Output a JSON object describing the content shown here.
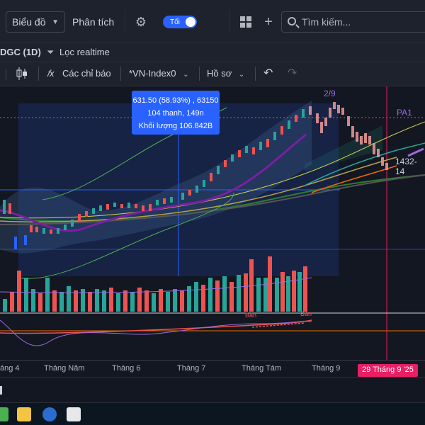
{
  "toolbar": {
    "chart_menu": "Biểu đồ",
    "analysis": "Phân tích",
    "theme_label": "Tối",
    "search_placeholder": "Tìm kiếm..."
  },
  "symbol_bar": {
    "symbol": "DGC (1D)",
    "filter_label": "Lọc realtime"
  },
  "chart_toolbar": {
    "indicators": "Các chỉ báo",
    "compare": "*VN-Index0",
    "profile": "Hồ sơ"
  },
  "tooltip": {
    "line1": "631.50 (58.93%) , 63150",
    "line2": "104 thanh, 149n",
    "line3": "Khối lượng 106.842B"
  },
  "annotations": {
    "wave": "2/9",
    "pa1": "PA1",
    "range": "1432-14",
    "ban1": "Bán",
    "ban2": "Bán"
  },
  "time_axis": {
    "labels": [
      "áng 4",
      "Tháng Năm",
      "Tháng 6",
      "Tháng 7",
      "Tháng Tám",
      "Tháng 9"
    ],
    "current_date": "29 Tháng 9 '25"
  },
  "colors": {
    "accent": "#2962ff",
    "up": "#26a69a",
    "down": "#ef5350",
    "date_marker": "#e91e63"
  }
}
